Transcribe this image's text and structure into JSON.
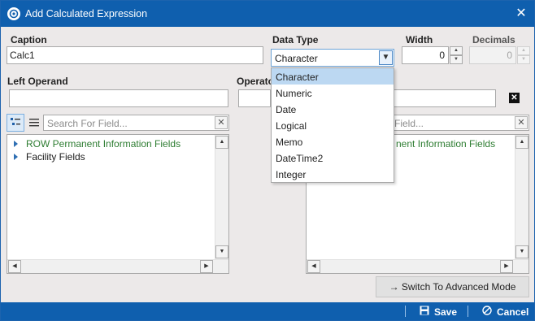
{
  "window": {
    "title": "Add Calculated Expression",
    "close_glyph": "✕"
  },
  "form": {
    "caption_label": "Caption",
    "caption_value": "Calc1",
    "data_type_label": "Data Type",
    "data_type_value": "Character",
    "width_label": "Width",
    "width_value": "0",
    "decimals_label": "Decimals",
    "decimals_value": "0",
    "left_operand_label": "Left Operand",
    "operator_label": "Operato"
  },
  "data_type_options": [
    {
      "label": "Character",
      "selected": true
    },
    {
      "label": "Numeric",
      "selected": false
    },
    {
      "label": "Date",
      "selected": false
    },
    {
      "label": "Logical",
      "selected": false
    },
    {
      "label": "Memo",
      "selected": false
    },
    {
      "label": "DateTime2",
      "selected": false
    },
    {
      "label": "Integer",
      "selected": false
    }
  ],
  "left_panel": {
    "search_placeholder": "Search For Field...",
    "tree": [
      {
        "label": "ROW Permanent Information Fields",
        "color": "#2e7d32"
      },
      {
        "label": "Facility Fields",
        "color": "#222222"
      }
    ]
  },
  "right_panel": {
    "search_placeholder_visible": "Field...",
    "tree_visible_text": "nent Information Fields"
  },
  "switch_button_label": "Switch To Advanced Mode",
  "footer": {
    "save_label": "Save",
    "cancel_label": "Cancel"
  },
  "colors": {
    "titlebar": "#0f5fae",
    "selection": "#bcd8f2"
  },
  "icons": {
    "app": "app-logo-icon",
    "close": "close-icon",
    "tree_view": "tree-view-icon",
    "list_view": "list-view-icon",
    "clear": "clear-icon",
    "arrow_right": "arrow-right-icon",
    "save": "save-icon",
    "cancel": "cancel-icon"
  }
}
